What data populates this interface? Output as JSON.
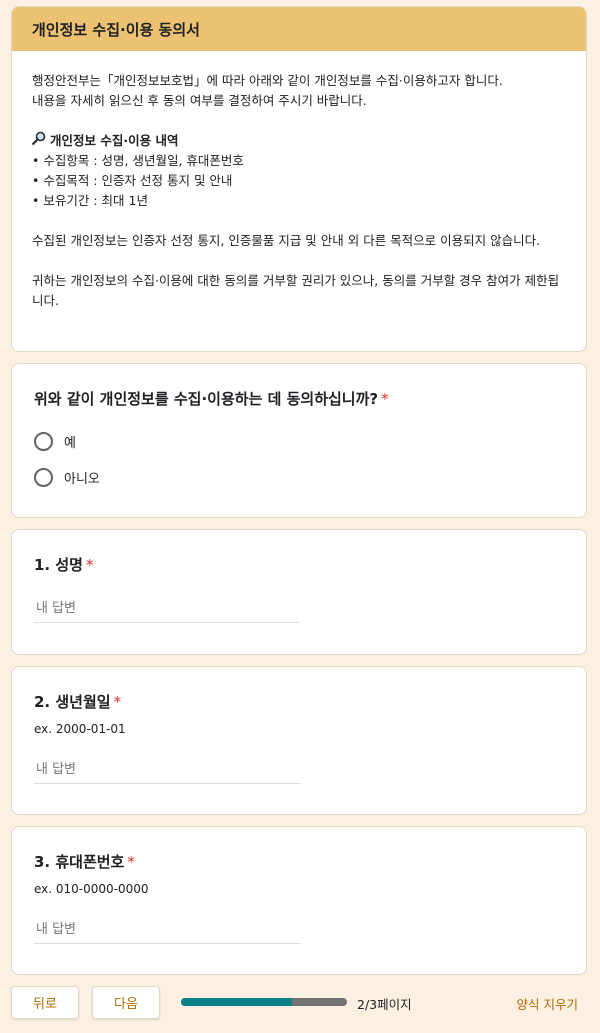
{
  "consent": {
    "title": "개인정보 수집·이용 동의서",
    "intro_line1": "행정안전부는「개인정보보호법」에 따라 아래와 같이 개인정보를 수집·이용하고자 합니다.",
    "intro_line2": "내용을 자세히 읽으신 후 동의 여부를 결정하여 주시기 바랍니다.",
    "section_icon": "magnifier-icon",
    "section_title": "개인정보 수집·이용 내역",
    "items": [
      "수집항목 : 성명, 생년월일, 휴대폰번호",
      "수집목적 : 인증자 선정 통지 및 안내",
      "보유기간 : 최대 1년"
    ],
    "note1": "수집된 개인정보는 인증자 선정 통지, 인증물품 지급 및 안내 외 다른 목적으로 이용되지 않습니다.",
    "note2": "귀하는 개인정보의 수집·이용에 대한 동의를 거부할 권리가 있으나, 동의를 거부할 경우 참여가 제한됩니다."
  },
  "agree_question": {
    "title": "위와 같이 개인정보를 수집·이용하는 데 동의하십니까?",
    "required_mark": "*",
    "options": [
      "예",
      "아니오"
    ]
  },
  "fields": [
    {
      "title": "1. 성명",
      "required_mark": "*",
      "description": "",
      "placeholder": "내 답변"
    },
    {
      "title": "2. 생년월일",
      "required_mark": "*",
      "description": "ex. 2000-01-01",
      "placeholder": "내 답변"
    },
    {
      "title": "3. 휴대폰번호",
      "required_mark": "*",
      "description": "ex. 010-0000-0000",
      "placeholder": "내 답변"
    }
  ],
  "footer": {
    "back_label": "뒤로",
    "next_label": "다음",
    "progress_fraction": 0.667,
    "progress_text": "2/3페이지",
    "clear_label": "양식 지우기"
  },
  "colors": {
    "background": "#fbf0e1",
    "header_accent": "#ecc172",
    "progress_fill": "#0d8087",
    "button_text": "#b26a00",
    "required": "#d93025"
  }
}
